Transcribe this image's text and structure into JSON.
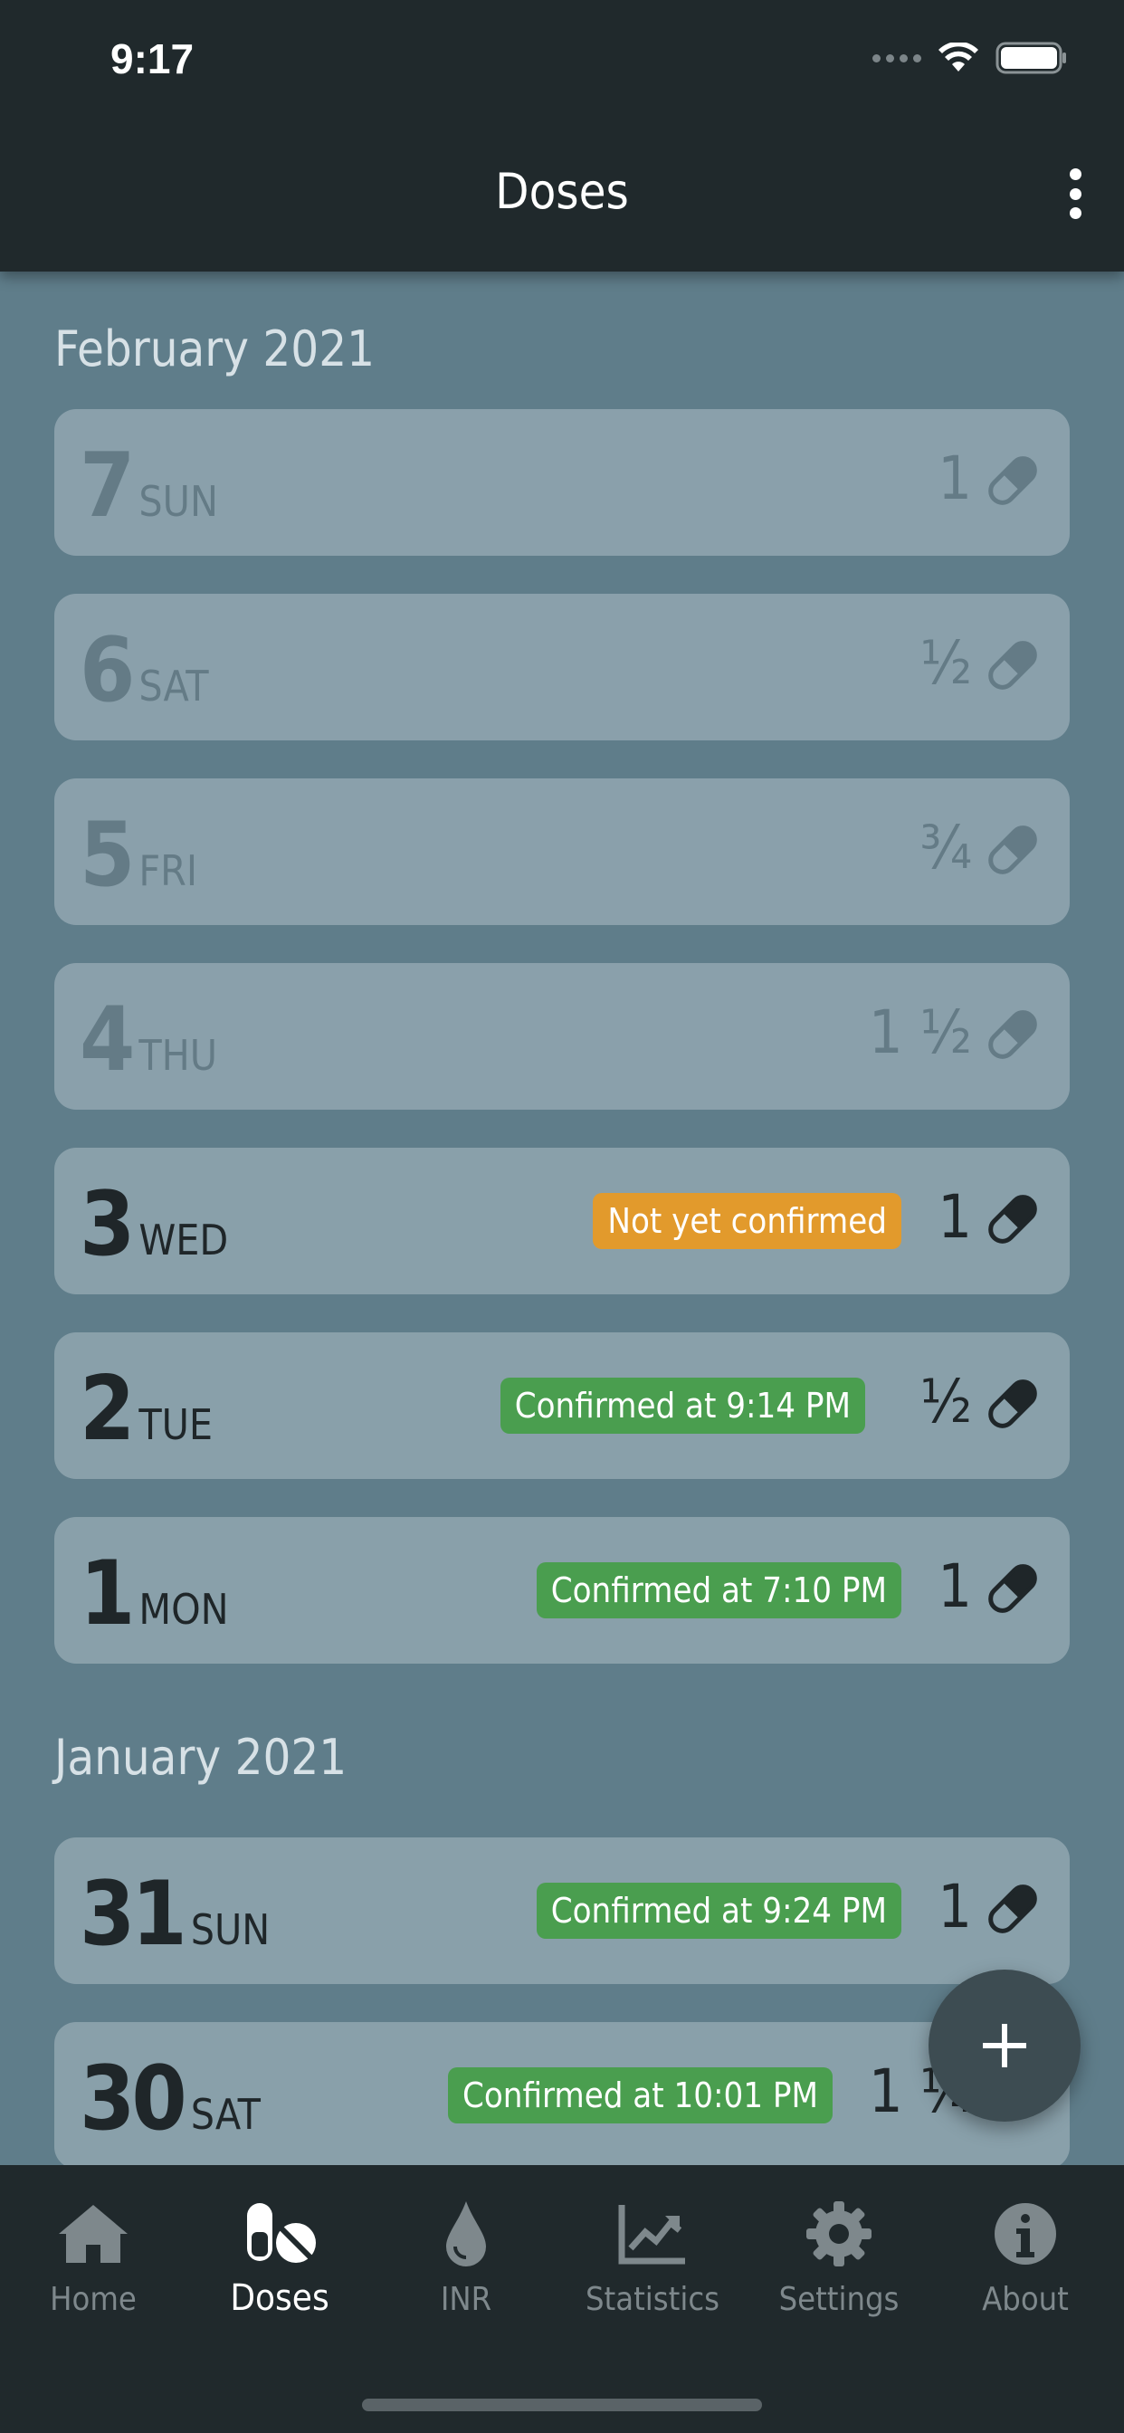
{
  "status": {
    "time": "9:17"
  },
  "header": {
    "title": "Doses"
  },
  "sections": [
    {
      "month": "February 2021",
      "days": [
        {
          "num": "7",
          "weekday": "SUN",
          "dose": "1",
          "status": "",
          "state": "future"
        },
        {
          "num": "6",
          "weekday": "SAT",
          "dose": "½",
          "status": "",
          "state": "future"
        },
        {
          "num": "5",
          "weekday": "FRI",
          "dose": "¾",
          "status": "",
          "state": "future"
        },
        {
          "num": "4",
          "weekday": "THU",
          "dose": "1 ½",
          "status": "",
          "state": "future"
        },
        {
          "num": "3",
          "weekday": "WED",
          "dose": "1",
          "status": "Not yet confirmed",
          "state": "pending"
        },
        {
          "num": "2",
          "weekday": "TUE",
          "dose": "½",
          "status": "Confirmed at 9:14 PM",
          "state": "confirmed"
        },
        {
          "num": "1",
          "weekday": "MON",
          "dose": "1",
          "status": "Confirmed at 7:10 PM",
          "state": "confirmed"
        }
      ]
    },
    {
      "month": "January 2021",
      "days": [
        {
          "num": "31",
          "weekday": "SUN",
          "dose": "1",
          "status": "Confirmed at 9:24 PM",
          "state": "confirmed"
        },
        {
          "num": "30",
          "weekday": "SAT",
          "dose": "1 ¼",
          "status": "Confirmed at 10:01 PM",
          "state": "confirmed"
        }
      ]
    }
  ],
  "fab": {
    "icon": "plus-icon"
  },
  "nav": [
    {
      "label": "Home",
      "icon": "home-icon"
    },
    {
      "label": "Doses",
      "icon": "pills-icon",
      "active": true
    },
    {
      "label": "INR",
      "icon": "drop-icon"
    },
    {
      "label": "Statistics",
      "icon": "chart-icon"
    },
    {
      "label": "Settings",
      "icon": "gear-icon"
    },
    {
      "label": "About",
      "icon": "info-icon"
    }
  ],
  "colors": {
    "confirmed": "#4a9e4f",
    "pending": "#e29a2c",
    "card": "#89a0aa",
    "bar": "#20292c"
  }
}
